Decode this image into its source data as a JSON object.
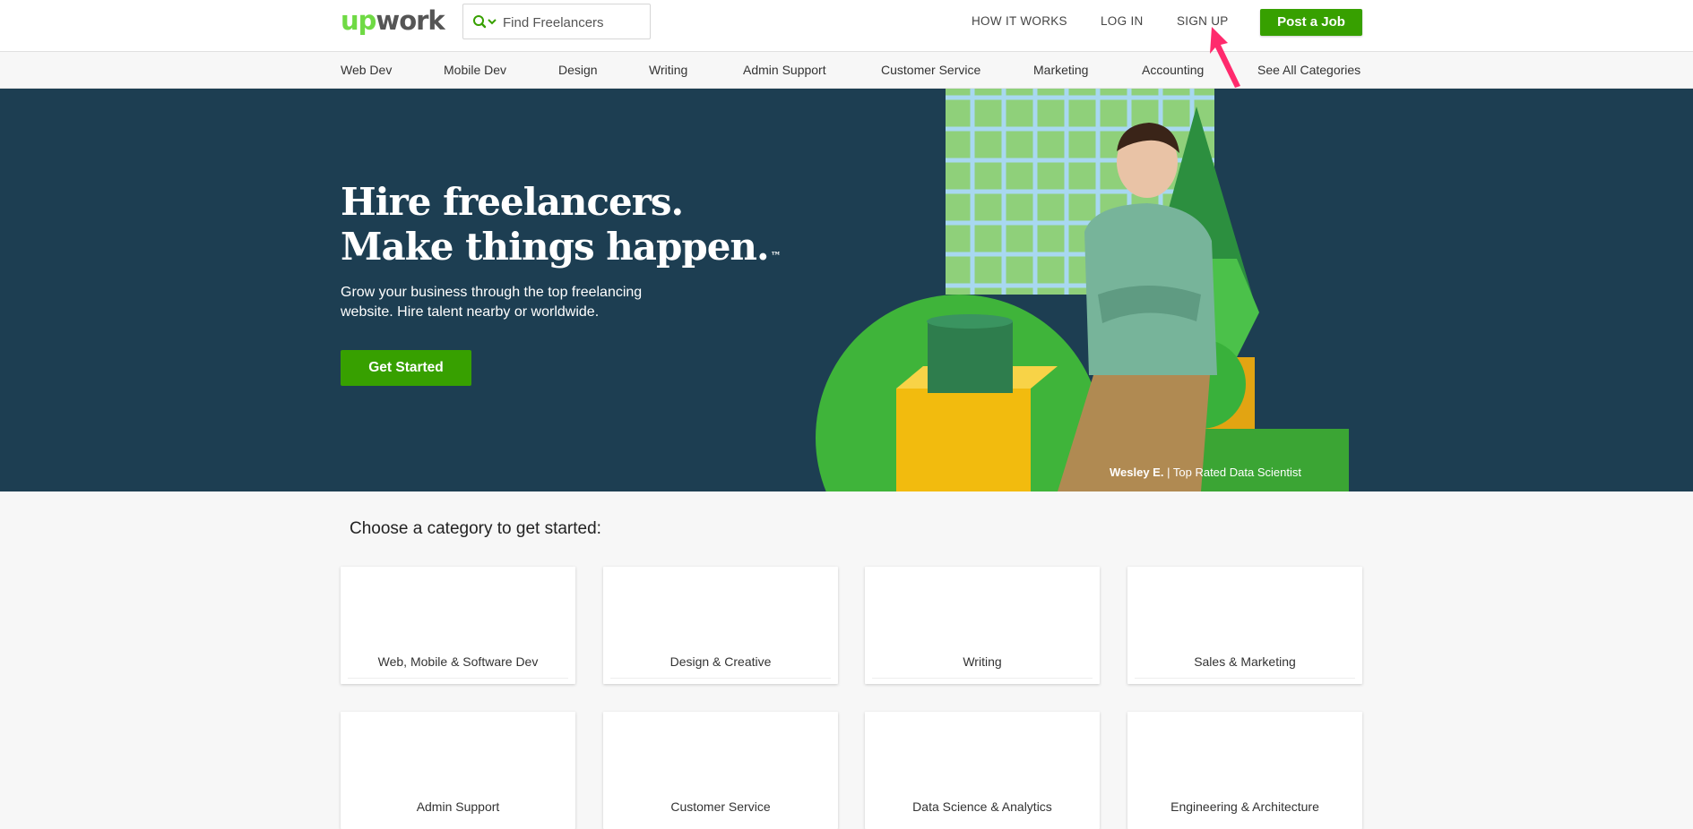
{
  "header": {
    "logo_up": "up",
    "logo_work": "work",
    "search_placeholder": "Find Freelancers",
    "nav": {
      "how_it_works": "HOW IT WORKS",
      "log_in": "LOG IN",
      "sign_up": "SIGN UP"
    },
    "post_job": "Post a Job"
  },
  "subnav": {
    "items": [
      "Web Dev",
      "Mobile Dev",
      "Design",
      "Writing",
      "Admin Support",
      "Customer Service",
      "Marketing",
      "Accounting",
      "See All Categories"
    ]
  },
  "hero": {
    "title_line1": "Hire freelancers.",
    "title_line2": "Make things happen.",
    "tm": "™",
    "subtitle": "Grow your business through the top freelancing website. Hire talent nearby or worldwide.",
    "cta": "Get Started",
    "caption_name": "Wesley E.",
    "caption_sep": "|",
    "caption_role": "Top Rated Data Scientist"
  },
  "categories": {
    "title": "Choose a category to get started:",
    "items": [
      "Web, Mobile & Software Dev",
      "Design & Creative",
      "Writing",
      "Sales & Marketing",
      "Admin Support",
      "Customer Service",
      "Data Science & Analytics",
      "Engineering & Architecture"
    ]
  },
  "colors": {
    "brand_green": "#37a000",
    "logo_green": "#6fda44",
    "hero_bg": "#1d3e52",
    "annotation_arrow": "#ff2a6d"
  }
}
